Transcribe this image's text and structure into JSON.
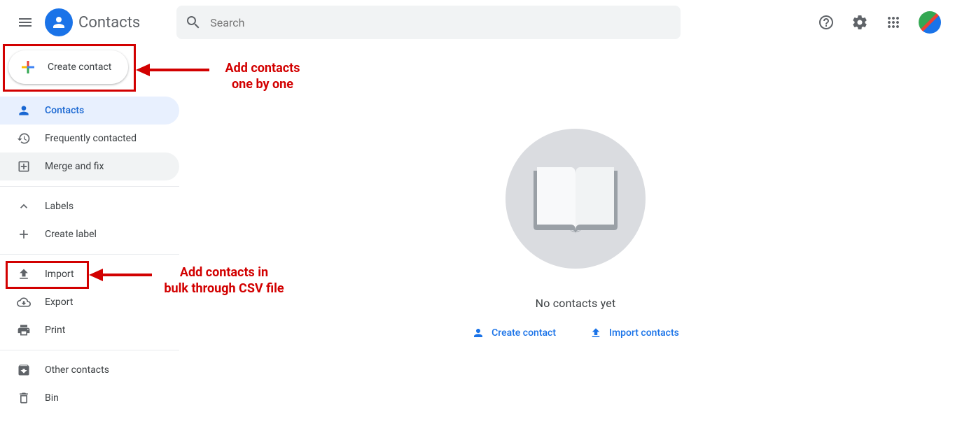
{
  "header": {
    "app_title": "Contacts",
    "search_placeholder": "Search"
  },
  "sidebar": {
    "create_label": "Create contact",
    "nav": {
      "contacts": "Contacts",
      "frequently": "Frequently contacted",
      "merge": "Merge and fix",
      "labels": "Labels",
      "create_label": "Create label",
      "import": "Import",
      "export": "Export",
      "print": "Print",
      "other": "Other contacts",
      "bin": "Bin"
    }
  },
  "main": {
    "empty_title": "No contacts yet",
    "create_action": "Create contact",
    "import_action": "Import contacts"
  },
  "annotations": {
    "create_note_l1": "Add contacts",
    "create_note_l2": "one by one",
    "import_note_l1": "Add contacts in",
    "import_note_l2": "bulk through CSV file"
  }
}
